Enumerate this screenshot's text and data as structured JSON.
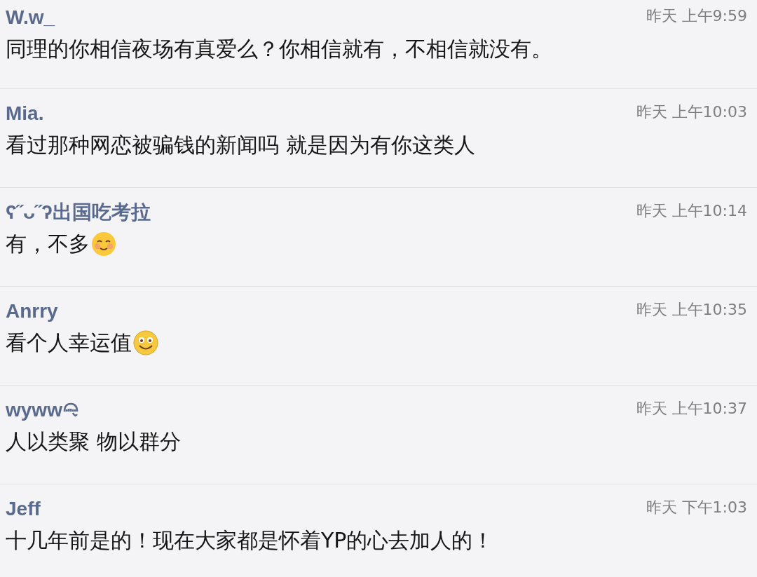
{
  "comments": [
    {
      "name": "W.w_",
      "time": "昨天 上午9:59",
      "text": "同理的你相信夜场有真爱么？你相信就有，不相信就没有。",
      "kind": "plain"
    },
    {
      "name": "Mia.",
      "time": "昨天 上午10:03",
      "text": "看过那种网恋被骗钱的新闻吗 就是因为有你这类人",
      "kind": "plain"
    },
    {
      "name": "ʕ˝ᴗ˝ʔ出国吃考拉",
      "time": "昨天 上午10:14",
      "text": "有，不多",
      "kind": "blush"
    },
    {
      "name": "Anrry",
      "time": "昨天 上午10:35",
      "text": "看个人幸运值",
      "kind": "smile"
    },
    {
      "name": "wyww",
      "time": "昨天 上午10:37",
      "text": "人以类聚 物以群分",
      "kind": "doodle"
    },
    {
      "name": "Jeff",
      "time": "昨天 下午1:03",
      "text": "十几年前是的！现在大家都是怀着YP的心去加人的！",
      "kind": "plain"
    }
  ]
}
